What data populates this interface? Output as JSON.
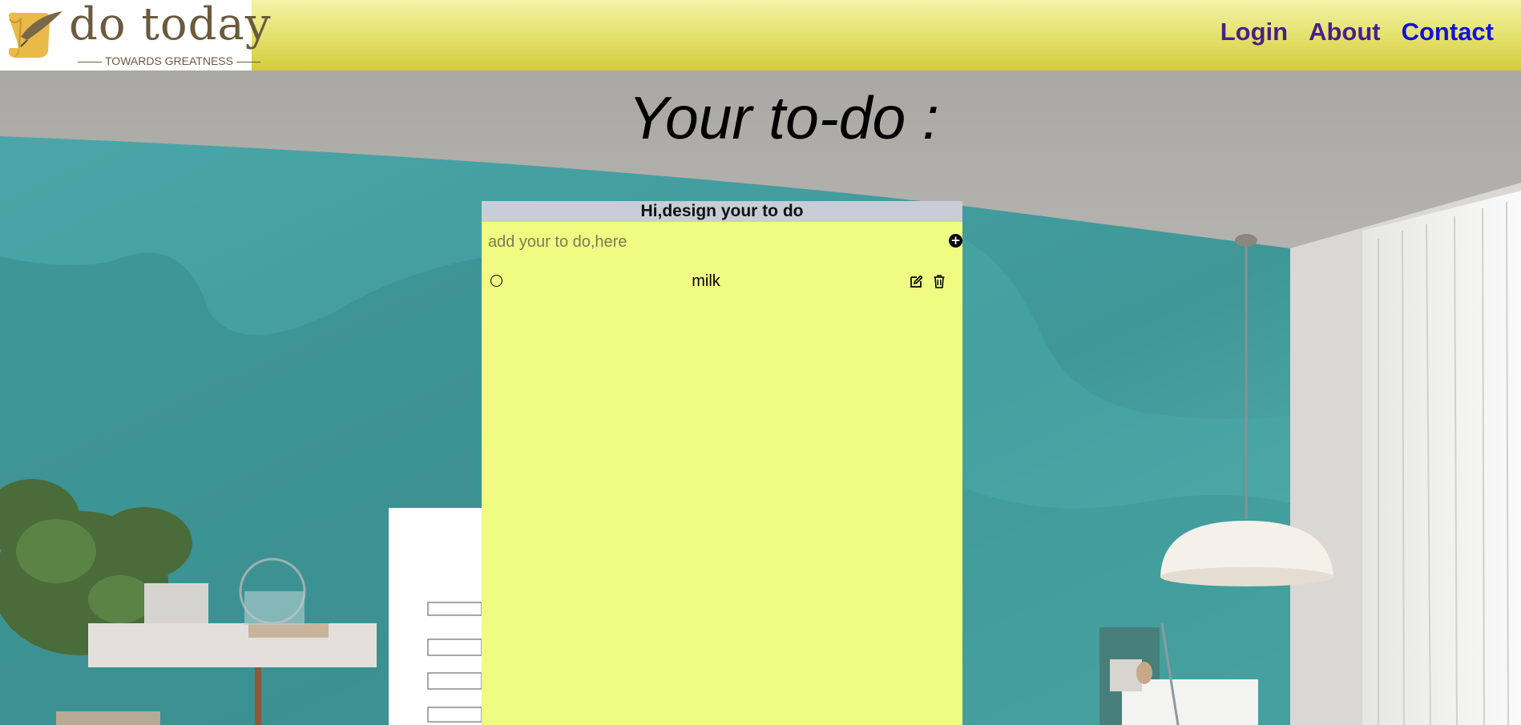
{
  "brand": {
    "name": "do today",
    "tagline": "TOWARDS GREATNESS",
    "logo_icon": "scroll-quill-icon"
  },
  "nav": {
    "items": [
      {
        "label": "Login",
        "state": "visited"
      },
      {
        "label": "About",
        "state": "visited"
      },
      {
        "label": "Contact",
        "state": "link"
      }
    ]
  },
  "page": {
    "title": "Your to-do :"
  },
  "todo_card": {
    "heading": "Hi,design your to do",
    "input": {
      "placeholder": "add your to do,here",
      "value": ""
    },
    "add_icon": "plus-circle-icon",
    "items": [
      {
        "text": "milk",
        "done": false,
        "edit_icon": "edit-icon",
        "delete_icon": "trash-icon"
      }
    ]
  },
  "colors": {
    "header_top": "#f3f3a6",
    "header_bottom": "#d3cc3a",
    "card_bg": "#f0fc81",
    "card_heading_bg": "#c8cdd7",
    "nav_visited": "#4a1f86",
    "nav_link": "#1111dd",
    "wall": "#3f9a9b"
  }
}
